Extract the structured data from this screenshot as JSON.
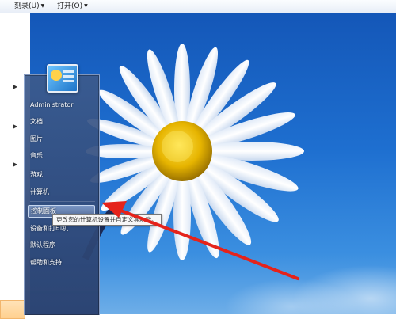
{
  "menubar": {
    "items": [
      {
        "label": "刻录(U)"
      },
      {
        "label": "打开(O)"
      }
    ]
  },
  "start_menu": {
    "user": "Administrator",
    "items": [
      {
        "label": "文档"
      },
      {
        "label": "图片"
      },
      {
        "label": "音乐"
      },
      {
        "label": "游戏"
      },
      {
        "label": "计算机"
      },
      {
        "label": "控制面板"
      },
      {
        "label": "设备和打印机"
      },
      {
        "label": "默认程序"
      },
      {
        "label": "帮助和支持"
      }
    ],
    "selected_item": "控制面板"
  },
  "tooltip": {
    "text": "更改您的计算机设置并自定义其功能。"
  },
  "colors": {
    "annotation_arrow": "#e5231b",
    "accent": "#1e6fd0"
  }
}
